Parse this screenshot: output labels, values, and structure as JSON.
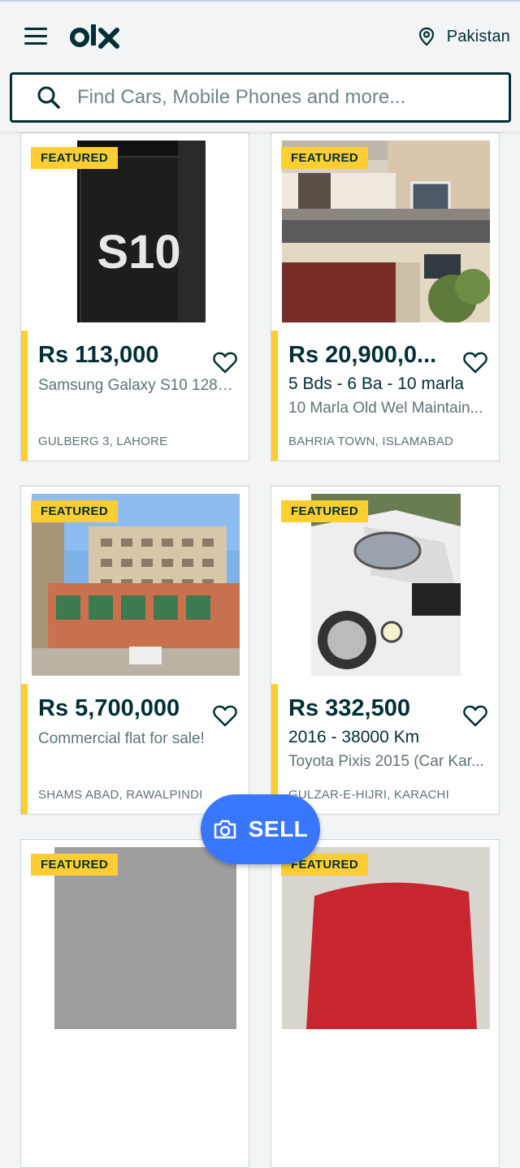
{
  "header": {
    "location": "Pakistan",
    "search_placeholder": "Find Cars, Mobile Phones and more..."
  },
  "listings": [
    {
      "badge": "FEATURED",
      "price": "Rs 113,000",
      "subtitle": "",
      "title": "Samsung Galaxy S10 128G...",
      "location": "GULBERG 3, LAHORE",
      "image": "phone-box"
    },
    {
      "badge": "FEATURED",
      "price": "Rs 20,900,0...",
      "subtitle": "5 Bds - 6 Ba - 10 marla",
      "title": "10 Marla Old Wel Maintain...",
      "location": "BAHRIA TOWN, ISLAMABAD",
      "image": "house"
    },
    {
      "badge": "FEATURED",
      "price": "Rs 5,700,000",
      "subtitle": "",
      "title": "Commercial flat for sale!",
      "location": "SHAMS ABAD, RAWALPINDI",
      "image": "building"
    },
    {
      "badge": "FEATURED",
      "price": "Rs 332,500",
      "subtitle": "2016 - 38000 Km",
      "title": "Toyota Pixis 2015 (Car Kar...",
      "location": "GULZAR-E-HIJRI, KARACHI",
      "image": "car"
    },
    {
      "badge": "FEATURED",
      "image": "gray"
    },
    {
      "badge": "FEATURED",
      "image": "red-car"
    }
  ],
  "phone_box_text": "S10",
  "sell_button": {
    "label": "SELL"
  },
  "colors": {
    "brand": "#002f34",
    "featured": "#ffce32",
    "sell": "#3a77ff"
  }
}
